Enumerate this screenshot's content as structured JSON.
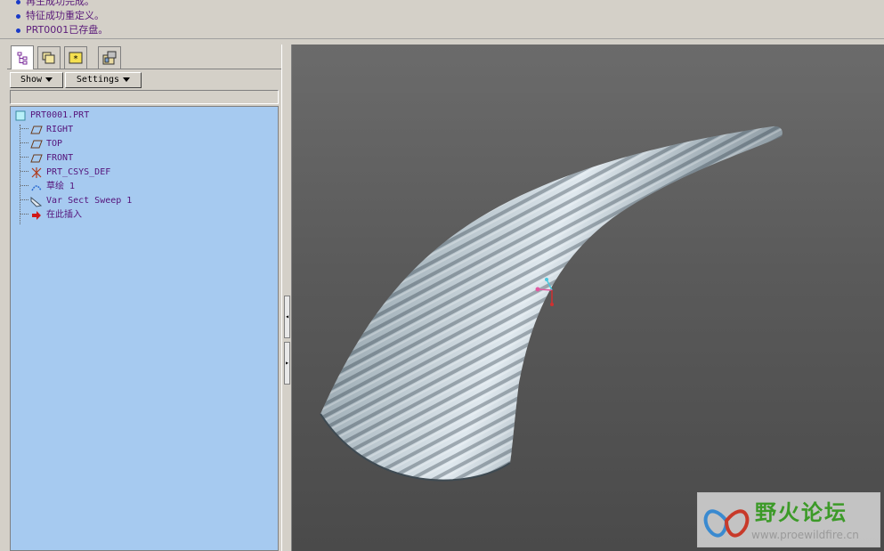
{
  "messages": [
    "再生成功完成。",
    "特征成功重定义。",
    "PRT0001已存盘。"
  ],
  "tabs": [
    {
      "icon": "model-tree-icon",
      "active": true
    },
    {
      "icon": "folder-browser-icon",
      "active": false
    },
    {
      "icon": "favorites-icon",
      "active": false
    },
    {
      "icon": "connections-icon",
      "active": false
    }
  ],
  "toolbar": {
    "show_label": "Show",
    "settings_label": "Settings"
  },
  "tree": {
    "root": "PRT0001.PRT",
    "items": [
      {
        "label": "RIGHT",
        "icon": "datum-plane-icon"
      },
      {
        "label": "TOP",
        "icon": "datum-plane-icon"
      },
      {
        "label": "FRONT",
        "icon": "datum-plane-icon"
      },
      {
        "label": "PRT_CSYS_DEF",
        "icon": "coordinate-system-icon"
      },
      {
        "label": "草绘 1",
        "icon": "sketch-icon"
      },
      {
        "label": "Var Sect Sweep 1",
        "icon": "sweep-feature-icon"
      },
      {
        "label": "在此插入",
        "icon": "insert-here-arrow-icon"
      }
    ]
  },
  "splitter": {
    "collapse_glyph": "◂",
    "expand_glyph": "▸"
  },
  "viewport": {
    "model_color": "#a9b6be",
    "background": "#5e5e5e"
  },
  "watermark": {
    "title": "野火论坛",
    "url": "www.proewildfire.cn"
  }
}
